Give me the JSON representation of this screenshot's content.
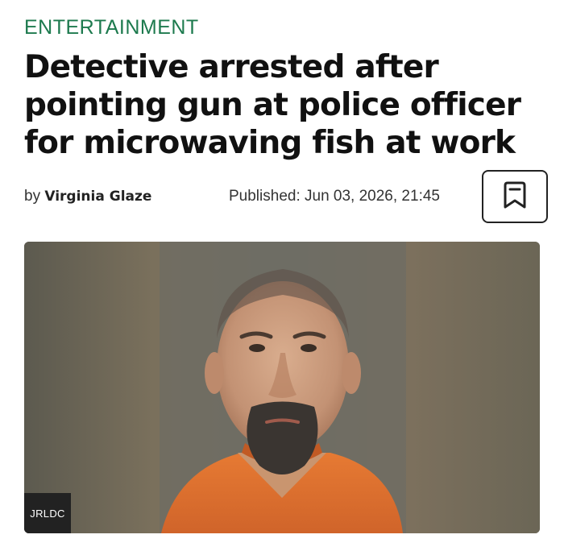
{
  "article": {
    "category": "ENTERTAINMENT",
    "headline": "Detective arrested after pointing gun at police officer for microwaving fish at work",
    "byline_prefix": "by",
    "author": "Virginia Glaze",
    "published": "Published: Jun 03, 2026, 21:45"
  },
  "bookmark": {
    "icon": "bookmark-icon"
  },
  "image": {
    "credit": "JRLDC"
  },
  "colors": {
    "category": "#1d7a4e",
    "headline": "#111111",
    "credit_bg": "#222222",
    "jumpsuit": "#e0742f"
  }
}
